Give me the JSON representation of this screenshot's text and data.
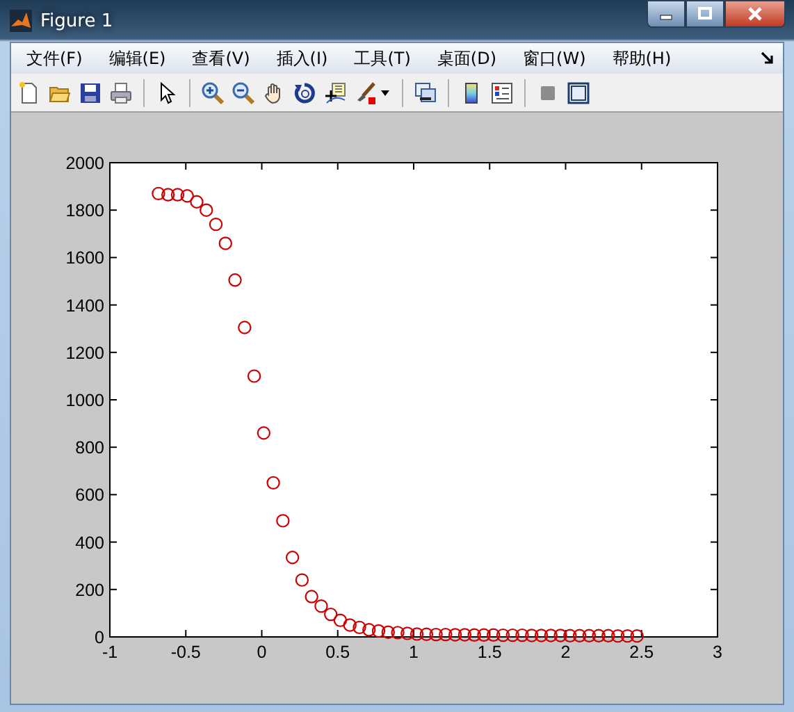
{
  "window": {
    "title": "Figure 1"
  },
  "menu": [
    "文件(F)",
    "编辑(E)",
    "查看(V)",
    "插入(I)",
    "工具(T)",
    "桌面(D)",
    "窗口(W)",
    "帮助(H)"
  ],
  "figure": {
    "axes": {
      "chart_data": {
        "type": "scatter",
        "x": [
          -0.68,
          -0.617,
          -0.554,
          -0.491,
          -0.428,
          -0.365,
          -0.302,
          -0.239,
          -0.176,
          -0.113,
          -0.05,
          0.013,
          0.076,
          0.139,
          0.202,
          0.265,
          0.328,
          0.391,
          0.454,
          0.517,
          0.58,
          0.643,
          0.706,
          0.769,
          0.832,
          0.895,
          0.958,
          1.021,
          1.084,
          1.147,
          1.21,
          1.273,
          1.336,
          1.399,
          1.462,
          1.525,
          1.588,
          1.651,
          1.714,
          1.777,
          1.84,
          1.903,
          1.966,
          2.029,
          2.092,
          2.155,
          2.218,
          2.281,
          2.344,
          2.407,
          2.47
        ],
        "series": [
          {
            "color": "#cc0000",
            "values": [
              1870,
              1865,
              1865,
              1860,
              1835,
              1800,
              1740,
              1660,
              1505,
              1305,
              1100,
              860,
              650,
              490,
              335,
              240,
              170,
              130,
              95,
              70,
              50,
              40,
              30,
              25,
              20,
              18,
              15,
              12,
              11,
              10,
              10,
              9,
              9,
              8,
              8,
              8,
              7,
              7,
              7,
              6,
              6,
              6,
              6,
              5,
              5,
              5,
              5,
              5,
              4,
              4,
              4
            ]
          }
        ],
        "xlim": [
          -1,
          3
        ],
        "ylim": [
          0,
          2000
        ],
        "xticks": [
          -1,
          -0.5,
          0,
          0.5,
          1,
          1.5,
          2,
          2.5,
          3
        ],
        "yticks": [
          0,
          200,
          400,
          600,
          800,
          1000,
          1200,
          1400,
          1600,
          1800,
          2000
        ]
      }
    }
  }
}
